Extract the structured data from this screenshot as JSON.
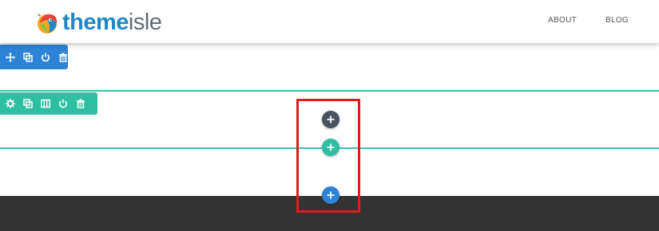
{
  "header": {
    "logo_word_bold": "theme",
    "logo_word_light": "isle",
    "nav": [
      {
        "label": "ABOUT"
      },
      {
        "label": "BLOG"
      }
    ]
  },
  "row_toolbar": {
    "icons": [
      "move-icon",
      "duplicate-icon",
      "power-icon",
      "trash-icon"
    ],
    "color": "#2d83d6"
  },
  "section_toolbar": {
    "icons": [
      "gear-icon",
      "duplicate-icon",
      "columns-icon",
      "power-icon",
      "trash-icon"
    ],
    "color": "#2ebfa2"
  },
  "add_buttons": [
    {
      "name": "add-content-button",
      "label": "+",
      "color": "#4a5160"
    },
    {
      "name": "add-section-button",
      "label": "+",
      "color": "#2ebfa2"
    },
    {
      "name": "add-row-button",
      "label": "+",
      "color": "#2d83d6"
    }
  ],
  "footer": {
    "left_text": "",
    "right_text": ""
  },
  "colors": {
    "highlight": "#e01b1b",
    "footer_bg": "#333333",
    "section_line": "#3cc1a8"
  }
}
